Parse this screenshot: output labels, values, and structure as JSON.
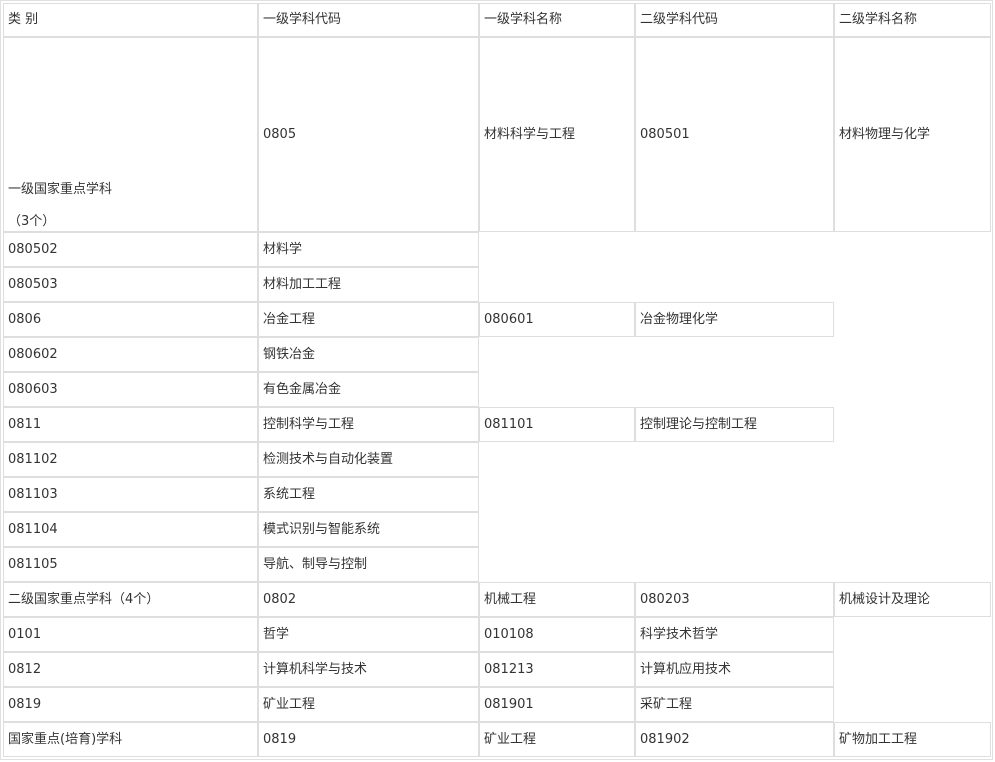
{
  "headers": [
    "类 别",
    "一级学科代码",
    "一级学科名称",
    "二级学科代码",
    "二级学科名称"
  ],
  "first_block": {
    "category_line1": "一级国家重点学科",
    "category_line2": "（3个）",
    "code1": "0805",
    "name1": "材料科学与工程",
    "code2": "080501",
    "name2": "材料物理与化学"
  },
  "rows": [
    {
      "c1": "080502",
      "c2": "材料学"
    },
    {
      "c1": "080503",
      "c2": "材料加工工程"
    },
    {
      "c1": "0806",
      "c2": "冶金工程",
      "c3": "080601",
      "c4": "冶金物理化学"
    },
    {
      "c1": "080602",
      "c2": "钢铁冶金"
    },
    {
      "c1": "080603",
      "c2": "有色金属冶金"
    },
    {
      "c1": "0811",
      "c2": "控制科学与工程",
      "c3": "081101",
      "c4": "控制理论与控制工程"
    },
    {
      "c1": "081102",
      "c2": "检测技术与自动化装置"
    },
    {
      "c1": "081103",
      "c2": "系统工程"
    },
    {
      "c1": "081104",
      "c2": "模式识别与智能系统"
    },
    {
      "c1": "081105",
      "c2": "导航、制导与控制"
    },
    {
      "c1": "二级国家重点学科（4个）",
      "c2": "0802",
      "c3": "机械工程",
      "c4": "080203",
      "c5": "机械设计及理论"
    },
    {
      "c1": "0101",
      "c2": "哲学",
      "c3": "010108",
      "c4": "科学技术哲学"
    },
    {
      "c1": "0812",
      "c2": "计算机科学与技术",
      "c3": "081213",
      "c4": "计算机应用技术"
    },
    {
      "c1": "0819",
      "c2": "矿业工程",
      "c3": "081901",
      "c4": "采矿工程"
    },
    {
      "c1": "国家重点(培育)学科",
      "c2": "0819",
      "c3": "矿业工程",
      "c4": "081902",
      "c5": "矿物加工工程"
    }
  ]
}
